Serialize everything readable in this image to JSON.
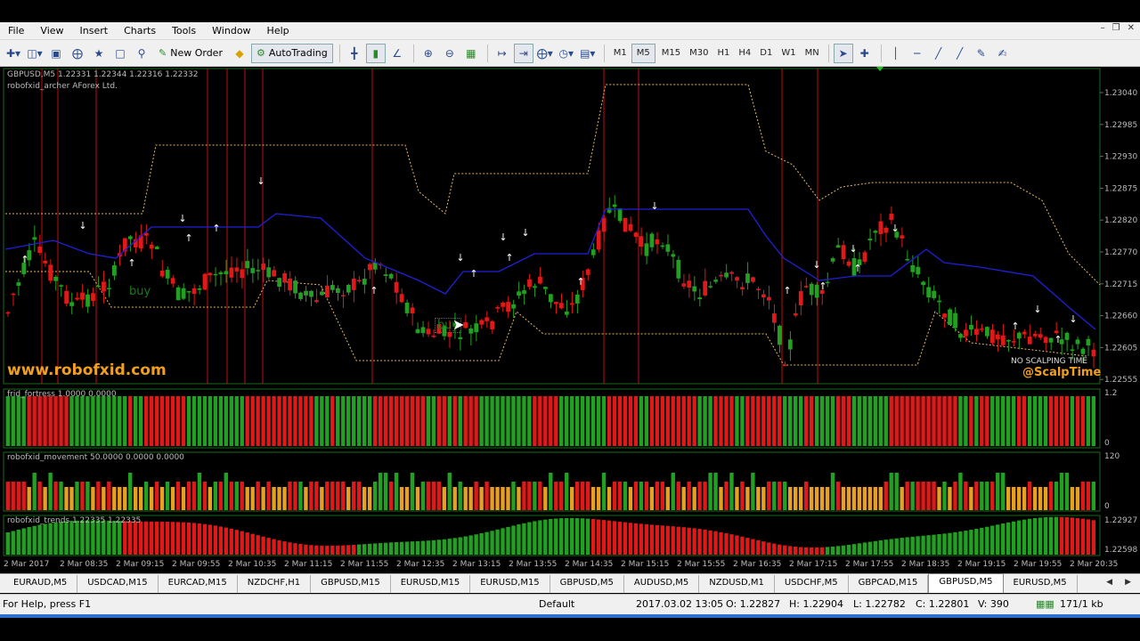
{
  "menu": [
    "File",
    "View",
    "Insert",
    "Charts",
    "Tools",
    "Window",
    "Help"
  ],
  "toolbar": {
    "new_order": "New Order",
    "autotrading": "AutoTrading",
    "timeframes": [
      "M1",
      "M5",
      "M15",
      "M30",
      "H1",
      "H4",
      "D1",
      "W1",
      "MN"
    ],
    "active_timeframe": "M5"
  },
  "chart": {
    "symbol_info": "GBPUSD,M5  1.22331 1.22344 1.22316 1.22332",
    "indicator_name": "robofxid_archer AForex Ltd.",
    "watermark": "www.robofxid.com",
    "no_scalping": "NO SCALPING TIME",
    "handle": "@ScalpTime",
    "buy_label_1": "buy",
    "buy_label_2": "buy",
    "price_ticks": [
      "1.23040",
      "1.22985",
      "1.22930",
      "1.22875",
      "1.22820",
      "1.22770",
      "1.22715",
      "1.22660",
      "1.22605",
      "1.22555"
    ],
    "colors": {
      "up": "#22a022",
      "down": "#e01818",
      "blue": "#2020d8",
      "envelope": "#e6b86a",
      "grid": "#1a6a1a",
      "text": "#bbbbbb"
    }
  },
  "panels": {
    "fortress": {
      "label": "frid_fortress 1.0000 0.0000",
      "ticks": [
        "1.2",
        "0"
      ]
    },
    "movement": {
      "label": "robofxid_movement 50.0000 0.0000 0.0000",
      "ticks": [
        "120",
        "0"
      ]
    },
    "trends": {
      "label": "robofxid_trends 1.22335 1.22335",
      "ticks": [
        "1.22927",
        "1.22598"
      ]
    }
  },
  "time_labels": [
    "2 Mar 2017",
    "2 Mar 08:35",
    "2 Mar 09:15",
    "2 Mar 09:55",
    "2 Mar 10:35",
    "2 Mar 11:15",
    "2 Mar 11:55",
    "2 Mar 12:35",
    "2 Mar 13:15",
    "2 Mar 13:55",
    "2 Mar 14:35",
    "2 Mar 15:15",
    "2 Mar 15:55",
    "2 Mar 16:35",
    "2 Mar 17:15",
    "2 Mar 17:55",
    "2 Mar 18:35",
    "2 Mar 19:15",
    "2 Mar 19:55",
    "2 Mar 20:35"
  ],
  "tabs": [
    "EURAUD,M5",
    "USDCAD,M15",
    "EURCAD,M15",
    "NZDCHF,H1",
    "GBPUSD,M15",
    "EURUSD,M15",
    "EURUSD,M15",
    "GBPUSD,M5",
    "AUDUSD,M5",
    "NZDUSD,M1",
    "USDCHF,M5",
    "GBPCAD,M15",
    "GBPUSD,M5",
    "EURUSD,M5"
  ],
  "active_tab": 12,
  "status": {
    "help": "For Help, press F1",
    "profile": "Default",
    "datetime": "2017.03.02 13:05",
    "open": "O: 1.22827",
    "high": "H: 1.22904",
    "low": "L: 1.22782",
    "close": "C: 1.22801",
    "volume": "V: 390",
    "traffic": "171/1 kb"
  }
}
